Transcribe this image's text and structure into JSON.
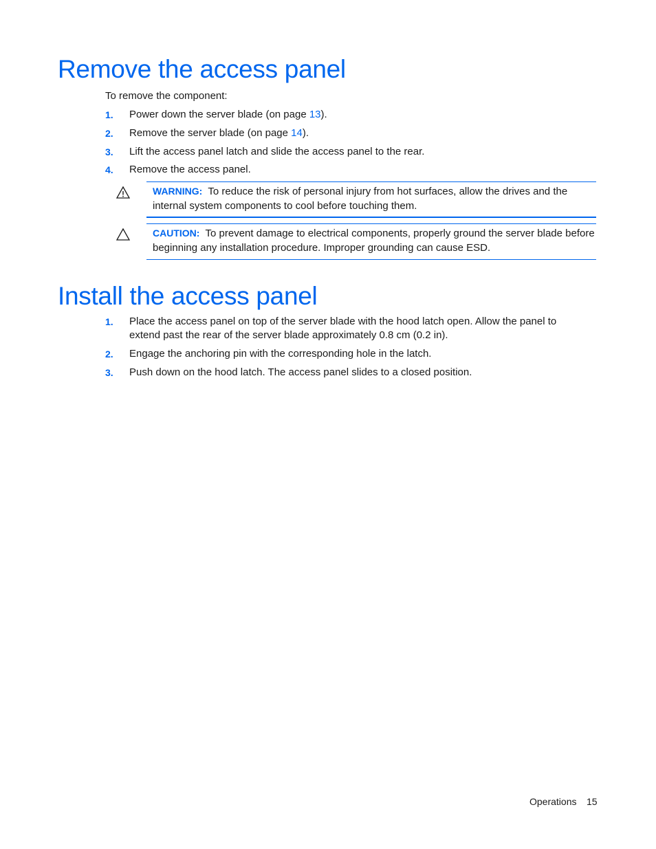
{
  "section_remove": {
    "title": "Remove the access panel",
    "intro": "To remove the component:",
    "steps": [
      {
        "num": "1.",
        "pre": "Power down the server blade (on page ",
        "link": "13",
        "post": ")."
      },
      {
        "num": "2.",
        "pre": "Remove the server blade (on page ",
        "link": "14",
        "post": ")."
      },
      {
        "num": "3.",
        "text": "Lift the access panel latch and slide the access panel to the rear."
      },
      {
        "num": "4.",
        "text": "Remove the access panel."
      }
    ],
    "warning": {
      "icon": "warning-exclamation-triangle-icon",
      "label": "WARNING:",
      "text": "To reduce the risk of personal injury from hot surfaces, allow the drives and the internal system components to cool before touching them."
    },
    "caution": {
      "icon": "caution-triangle-icon",
      "label": "CAUTION:",
      "text": "To prevent damage to electrical components, properly ground the server blade before beginning any installation procedure. Improper grounding can cause ESD."
    }
  },
  "section_install": {
    "title": "Install the access panel",
    "steps": [
      {
        "num": "1.",
        "text": "Place the access panel on top of the server blade with the hood latch open. Allow the panel to extend past the rear of the server blade approximately 0.8 cm (0.2 in)."
      },
      {
        "num": "2.",
        "text": "Engage the anchoring pin with the corresponding hole in the latch."
      },
      {
        "num": "3.",
        "text": "Push down on the hood latch. The access panel slides to a closed position."
      }
    ]
  },
  "footer": {
    "section": "Operations",
    "page": "15"
  },
  "colors": {
    "accent": "#0066ee",
    "text": "#1a1a1a"
  }
}
